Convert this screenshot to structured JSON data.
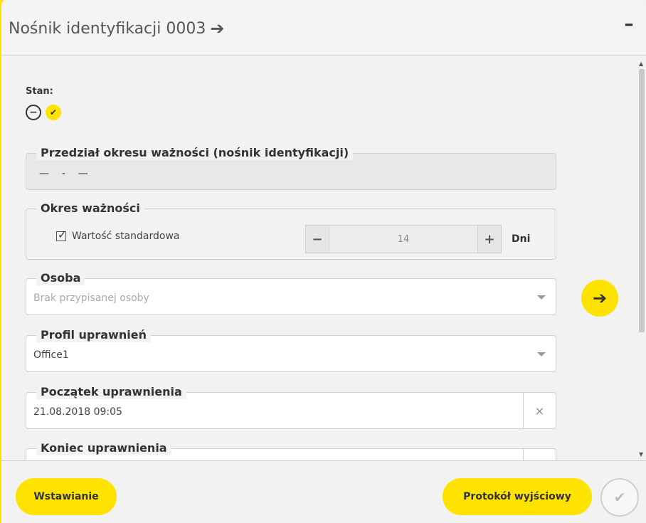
{
  "header": {
    "title": "Nośnik identyfikacji 0003",
    "title_arrow_icon": "arrow-right-icon",
    "minimize_label": "–"
  },
  "stan": {
    "label": "Stan:",
    "icons": [
      "minus-circle-icon",
      "check-circle-icon"
    ]
  },
  "validity_range": {
    "legend": "Przedział okresu ważności (nośnik identyfikacji)",
    "from": "—",
    "sep": "-",
    "to": "—"
  },
  "validity_period": {
    "legend": "Okres ważności",
    "checkbox_label": "Wartość standardowa",
    "checked": true,
    "minus": "−",
    "value": "14",
    "plus": "+",
    "unit": "Dni"
  },
  "person": {
    "legend": "Osoba",
    "placeholder": "Brak przypisanej osoby"
  },
  "profile": {
    "legend": "Profil uprawnień",
    "value": "Office1"
  },
  "start": {
    "legend": "Początek uprawnienia",
    "value": "21.08.2018 09:05",
    "clear": "×"
  },
  "end": {
    "legend": "Koniec uprawnienia"
  },
  "footer": {
    "insert_label": "Wstawianie",
    "protocol_label": "Protokół wyjściowy",
    "confirm_icon": "check-icon"
  },
  "colors": {
    "accent": "#ffe300",
    "background": "#f2f2f2"
  }
}
